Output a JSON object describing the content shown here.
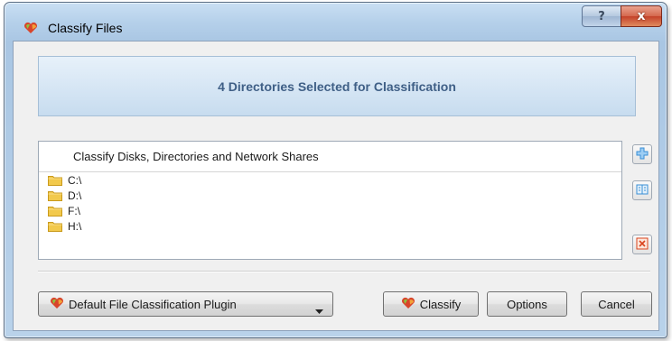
{
  "window": {
    "title": "Classify Files",
    "help_symbol": "?",
    "close_symbol": "x"
  },
  "banner": {
    "text": "4 Directories Selected for Classification"
  },
  "list": {
    "header": "Classify Disks, Directories and Network Shares",
    "items": [
      {
        "label": "C:\\",
        "icon": "folder-icon"
      },
      {
        "label": "D:\\",
        "icon": "folder-icon"
      },
      {
        "label": "F:\\",
        "icon": "folder-icon"
      },
      {
        "label": "H:\\",
        "icon": "folder-icon"
      }
    ]
  },
  "side_buttons": [
    {
      "icon": "add-icon"
    },
    {
      "icon": "properties-icon"
    },
    {
      "icon": "remove-icon"
    }
  ],
  "footer": {
    "plugin_select": "Default File Classification Plugin",
    "classify_label": "Classify",
    "options_label": "Options",
    "cancel_label": "Cancel"
  },
  "colors": {
    "banner_text": "#3f5f86",
    "folder_fill": "#f2c94c",
    "accent_add": "#3a8fd6",
    "accent_remove": "#d9441e"
  }
}
